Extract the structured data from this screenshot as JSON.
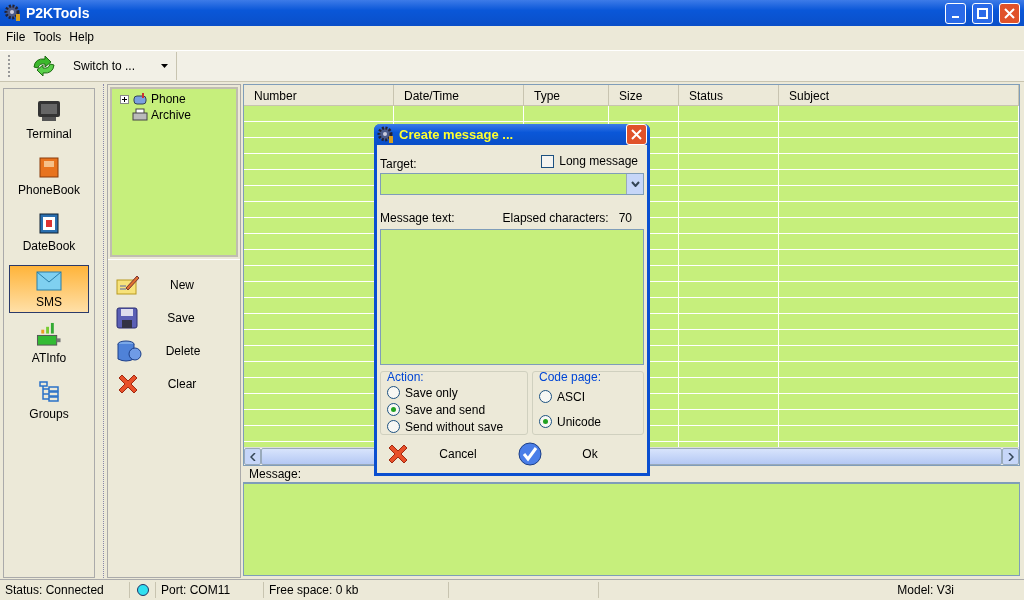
{
  "window": {
    "title": "P2KTools"
  },
  "menu": [
    "File",
    "Tools",
    "Help"
  ],
  "toolbar": {
    "switch_button": "Switch to ..."
  },
  "nav": [
    {
      "label": "Terminal",
      "kind": "terminal",
      "selected": false
    },
    {
      "label": "PhoneBook",
      "kind": "phonebook",
      "selected": false
    },
    {
      "label": "DateBook",
      "kind": "datebook",
      "selected": false
    },
    {
      "label": "SMS",
      "kind": "sms",
      "selected": true
    },
    {
      "label": "ATInfo",
      "kind": "atinfo",
      "selected": false
    },
    {
      "label": "Groups",
      "kind": "groups",
      "selected": false
    }
  ],
  "tree": [
    {
      "label": "Phone",
      "kind": "phone",
      "expanded": false
    },
    {
      "label": "Archive",
      "kind": "archive"
    }
  ],
  "actions": [
    {
      "label": "New",
      "kind": "new"
    },
    {
      "label": "Save",
      "kind": "save"
    },
    {
      "label": "Delete",
      "kind": "delete"
    },
    {
      "label": "Clear",
      "kind": "clear"
    }
  ],
  "table": {
    "columns": [
      "Number",
      "Date/Time",
      "Type",
      "Size",
      "Status",
      "Subject"
    ]
  },
  "message_panel": {
    "label": "Message:"
  },
  "dialog": {
    "title": "Create message ...",
    "target_label": "Target:",
    "long_message": {
      "label": "Long message",
      "checked": false
    },
    "message_text_label": "Message text:",
    "elapsed_label": "Elapsed characters:",
    "elapsed_count": "70",
    "action_group": {
      "title": "Action:",
      "options": [
        {
          "label": "Save only",
          "selected": false
        },
        {
          "label": "Save and send",
          "selected": true
        },
        {
          "label": "Send without save",
          "selected": false
        }
      ]
    },
    "code_page": {
      "title": "Code page:",
      "options": [
        {
          "label": "ASCI",
          "selected": false
        },
        {
          "label": "Unicode",
          "selected": true
        }
      ]
    },
    "cancel": "Cancel",
    "ok": "Ok"
  },
  "status_bar": {
    "status": "Status: Connected",
    "port": "Port: COM11",
    "free_space": "Free space: 0 kb",
    "model": "Model: V3i"
  }
}
